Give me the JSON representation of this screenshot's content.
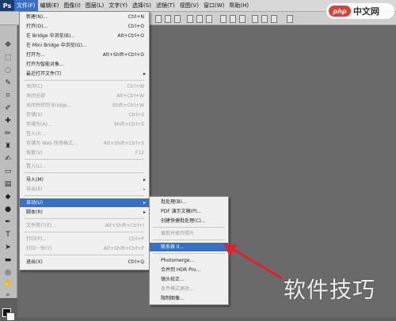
{
  "app": {
    "logo": "Ps"
  },
  "menubar": {
    "items": [
      "文件(F)",
      "编辑(E)",
      "图像(I)",
      "图层(L)",
      "文字(Y)",
      "选择(S)",
      "滤镜(T)",
      "视图(V)",
      "窗口(W)",
      "帮助(H)"
    ]
  },
  "file_menu": {
    "items": [
      {
        "label": "新建(N)...",
        "shortcut": "Ctrl+N"
      },
      {
        "label": "打开(O)...",
        "shortcut": "Ctrl+O"
      },
      {
        "label": "在 Bridge 中浏览(B)...",
        "shortcut": "Alt+Ctrl+O"
      },
      {
        "label": "在 Mini Bridge 中浏览(G)...",
        "shortcut": ""
      },
      {
        "label": "打开为...",
        "shortcut": "Alt+Shift+Ctrl+O"
      },
      {
        "label": "打开为智能对象...",
        "shortcut": ""
      },
      {
        "label": "最近打开文件(T)",
        "shortcut": ""
      },
      {
        "label": "关闭(C)",
        "shortcut": "Ctrl+W"
      },
      {
        "label": "关闭全部",
        "shortcut": "Alt+Ctrl+W"
      },
      {
        "label": "关闭并转到 Bridge...",
        "shortcut": "Shift+Ctrl+W"
      },
      {
        "label": "存储(S)",
        "shortcut": "Ctrl+S"
      },
      {
        "label": "存储为(A)...",
        "shortcut": "Shift+Ctrl+S"
      },
      {
        "label": "签入(I)...",
        "shortcut": ""
      },
      {
        "label": "存储为 Web 所用格式...",
        "shortcut": "Alt+Shift+Ctrl+S"
      },
      {
        "label": "恢复(V)",
        "shortcut": "F12"
      },
      {
        "label": "置入(L)...",
        "shortcut": ""
      },
      {
        "label": "导入(M)",
        "shortcut": ""
      },
      {
        "label": "导出(E)",
        "shortcut": ""
      },
      {
        "label": "自动(U)",
        "shortcut": ""
      },
      {
        "label": "脚本(R)",
        "shortcut": ""
      },
      {
        "label": "文件简介(F)...",
        "shortcut": "Alt+Shift+Ctrl+I"
      },
      {
        "label": "打印(P)...",
        "shortcut": "Ctrl+P"
      },
      {
        "label": "打印一份(Y)",
        "shortcut": "Alt+Shift+Ctrl+P"
      },
      {
        "label": "退出(X)",
        "shortcut": "Ctrl+Q"
      }
    ]
  },
  "auto_submenu": {
    "items": [
      {
        "label": "批处理(B)..."
      },
      {
        "label": "PDF 演示文稿(P)..."
      },
      {
        "label": "创建快捷批处理(C)..."
      },
      {
        "label": "裁剪并修齐照片"
      },
      {
        "label": "联系表 II..."
      },
      {
        "label": "Photomerge..."
      },
      {
        "label": "合并到 HDR Pro..."
      },
      {
        "label": "镜头校正..."
      },
      {
        "label": "条件模式更改..."
      },
      {
        "label": "限制图像..."
      }
    ]
  },
  "watermarks": {
    "php_badge": "php",
    "php_text": "中文网",
    "bottom": "软件技巧"
  },
  "colors": {
    "highlight": "#3b6fc7",
    "arrow": "#e0232b",
    "workspace": "#6a6a6a"
  }
}
